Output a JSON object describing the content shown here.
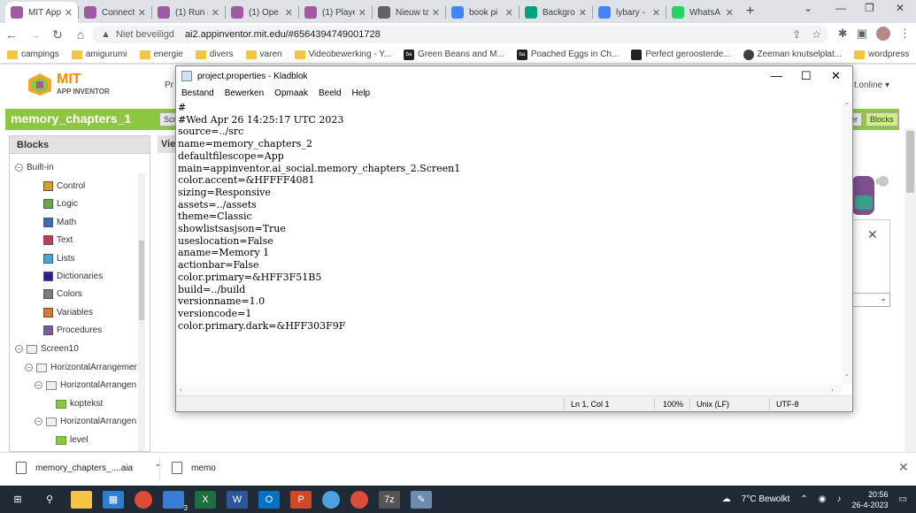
{
  "browser": {
    "tabs": [
      {
        "label": "MIT App",
        "active": true,
        "icon": "app-inventor-icon",
        "color": "#a05aa0"
      },
      {
        "label": "Connect",
        "active": false,
        "icon": "app-inventor-icon",
        "color": "#a05aa0"
      },
      {
        "label": "(1) Run a",
        "active": false,
        "icon": "app-inventor-icon",
        "color": "#a05aa0"
      },
      {
        "label": "(1) Ope",
        "active": false,
        "icon": "app-inventor-icon",
        "color": "#a05aa0"
      },
      {
        "label": "(1) Playe",
        "active": false,
        "icon": "app-inventor-icon",
        "color": "#a05aa0"
      },
      {
        "label": "Nieuw ta",
        "active": false,
        "icon": "chrome-icon",
        "color": "#5f6368"
      },
      {
        "label": "book pi",
        "active": false,
        "icon": "google-icon",
        "color": "#4285f4"
      },
      {
        "label": "Backgro",
        "active": false,
        "icon": "px-icon",
        "color": "#05a081"
      },
      {
        "label": "lybary -",
        "active": false,
        "icon": "google-icon",
        "color": "#4285f4"
      },
      {
        "label": "WhatsA",
        "active": false,
        "icon": "whatsapp-icon",
        "color": "#25d366"
      }
    ],
    "new_tab": "+",
    "address": {
      "security_label": "Niet beveiligd",
      "url": "ai2.appinventor.mit.edu/#6564394749001728"
    },
    "bookmarks": [
      {
        "label": "campings",
        "type": "folder"
      },
      {
        "label": "amigurumi",
        "type": "folder"
      },
      {
        "label": "energie",
        "type": "folder"
      },
      {
        "label": "divers",
        "type": "folder"
      },
      {
        "label": "varen",
        "type": "folder"
      },
      {
        "label": "Videobewerking - Y...",
        "type": "folder"
      },
      {
        "label": "Green Beans and M...",
        "type": "site",
        "icon": "ba"
      },
      {
        "label": "Poached Eggs in Ch...",
        "type": "site",
        "icon": "ba"
      },
      {
        "label": "Perfect geroosterde...",
        "type": "site",
        "icon": "person"
      },
      {
        "label": "Zeeman knutselplat...",
        "type": "site",
        "icon": "round"
      },
      {
        "label": "wordpress",
        "type": "folder"
      }
    ]
  },
  "app_inventor": {
    "brand": "MIT",
    "brand_sub": "APP INVENTOR",
    "menu_partial": "Pr",
    "account_partial": "t.online",
    "project_name": "memory_chapters_1",
    "screen_btn_partial": "Scr",
    "designer_partial": "er",
    "blocks_btn": "Blocks",
    "viewer_partial": "Vie",
    "palette": {
      "title": "Blocks",
      "builtin_label": "Built-in",
      "builtin_items": [
        {
          "label": "Control",
          "color": "#d4a12a"
        },
        {
          "label": "Logic",
          "color": "#6ba64a"
        },
        {
          "label": "Math",
          "color": "#3c6ab5"
        },
        {
          "label": "Text",
          "color": "#c23a5e"
        },
        {
          "label": "Lists",
          "color": "#4aa7d1"
        },
        {
          "label": "Dictionaries",
          "color": "#2d1f8c"
        },
        {
          "label": "Colors",
          "color": "#7a7a7a"
        },
        {
          "label": "Variables",
          "color": "#e07a2a"
        },
        {
          "label": "Procedures",
          "color": "#7c5a9e"
        }
      ],
      "components": [
        {
          "label": "Screen10",
          "level": 0
        },
        {
          "label": "HorizontalArrangemer",
          "level": 1
        },
        {
          "label": "HorizontalArrangen",
          "level": 2
        },
        {
          "label": "koptekst",
          "level": 3
        },
        {
          "label": "HorizontalArrangen",
          "level": 2
        },
        {
          "label": "level",
          "level": 3
        }
      ]
    }
  },
  "notepad": {
    "title": "project.properties - Kladblok",
    "menu": [
      "Bestand",
      "Bewerken",
      "Opmaak",
      "Beeld",
      "Help"
    ],
    "content": "#\n#Wed Apr 26 14:25:17 UTC 2023\nsource=../src\nname=memory_chapters_2\ndefaultfilescope=App\nmain=appinventor.ai_social.memory_chapters_2.Screen1\ncolor.accent=&HFFFF4081\nsizing=Responsive\nassets=../assets\ntheme=Classic\nshowlistsasjson=True\nuseslocation=False\naname=Memory 1\nactionbar=False\ncolor.primary=&HFF3F51B5\nbuild=../build\nversionname=1.0\nversioncode=1\ncolor.primary.dark=&HFF303F9F",
    "status": {
      "position": "Ln 1, Col 1",
      "zoom": "100%",
      "line_endings": "Unix (LF)",
      "encoding": "UTF-8"
    }
  },
  "downloads": [
    {
      "name": "memory_chapters_....aia"
    },
    {
      "name": "memo"
    }
  ],
  "taskbar": {
    "weather": "7°C  Bewolkt",
    "time": "20:56",
    "date": "26-4-2023",
    "outlook_badge": "3"
  }
}
